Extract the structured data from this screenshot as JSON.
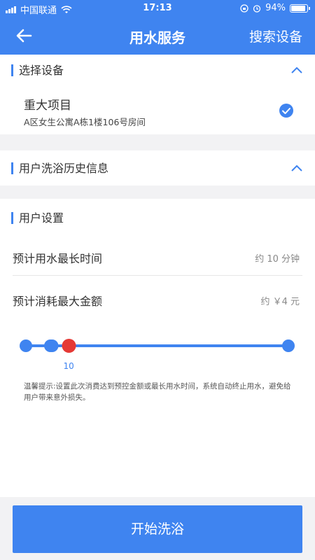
{
  "status_bar": {
    "carrier": "中国联通",
    "time": "17:13",
    "battery": "94%",
    "battery_level": 0.94
  },
  "nav": {
    "title": "用水服务",
    "action": "搜索设备",
    "back_icon": "back-arrow-icon"
  },
  "select_device": {
    "title": "选择设备",
    "device_name": "重大项目",
    "device_address": "A区女生公寓A栋1楼106号房间",
    "selected": true
  },
  "history": {
    "title": "用户洗浴历史信息"
  },
  "user_settings": {
    "title": "用户设置",
    "max_time_label": "预计用水最长时间",
    "max_time_value": "约 10 分钟",
    "max_cost_label": "预计消耗最大金额",
    "max_cost_value": "约 ￥4 元",
    "slider": {
      "current": 10,
      "min": 0,
      "max": 100,
      "stops": [
        0,
        10,
        100
      ],
      "current_label": "10"
    },
    "tip": "温馨提示:设置此次消费达到预控金额或最长用水时间，系统自动终止用水，避免给用户带来意外损失。"
  },
  "start_button": "开始洗浴",
  "colors": {
    "primary": "#3f84f0",
    "thumb": "#e53935"
  }
}
